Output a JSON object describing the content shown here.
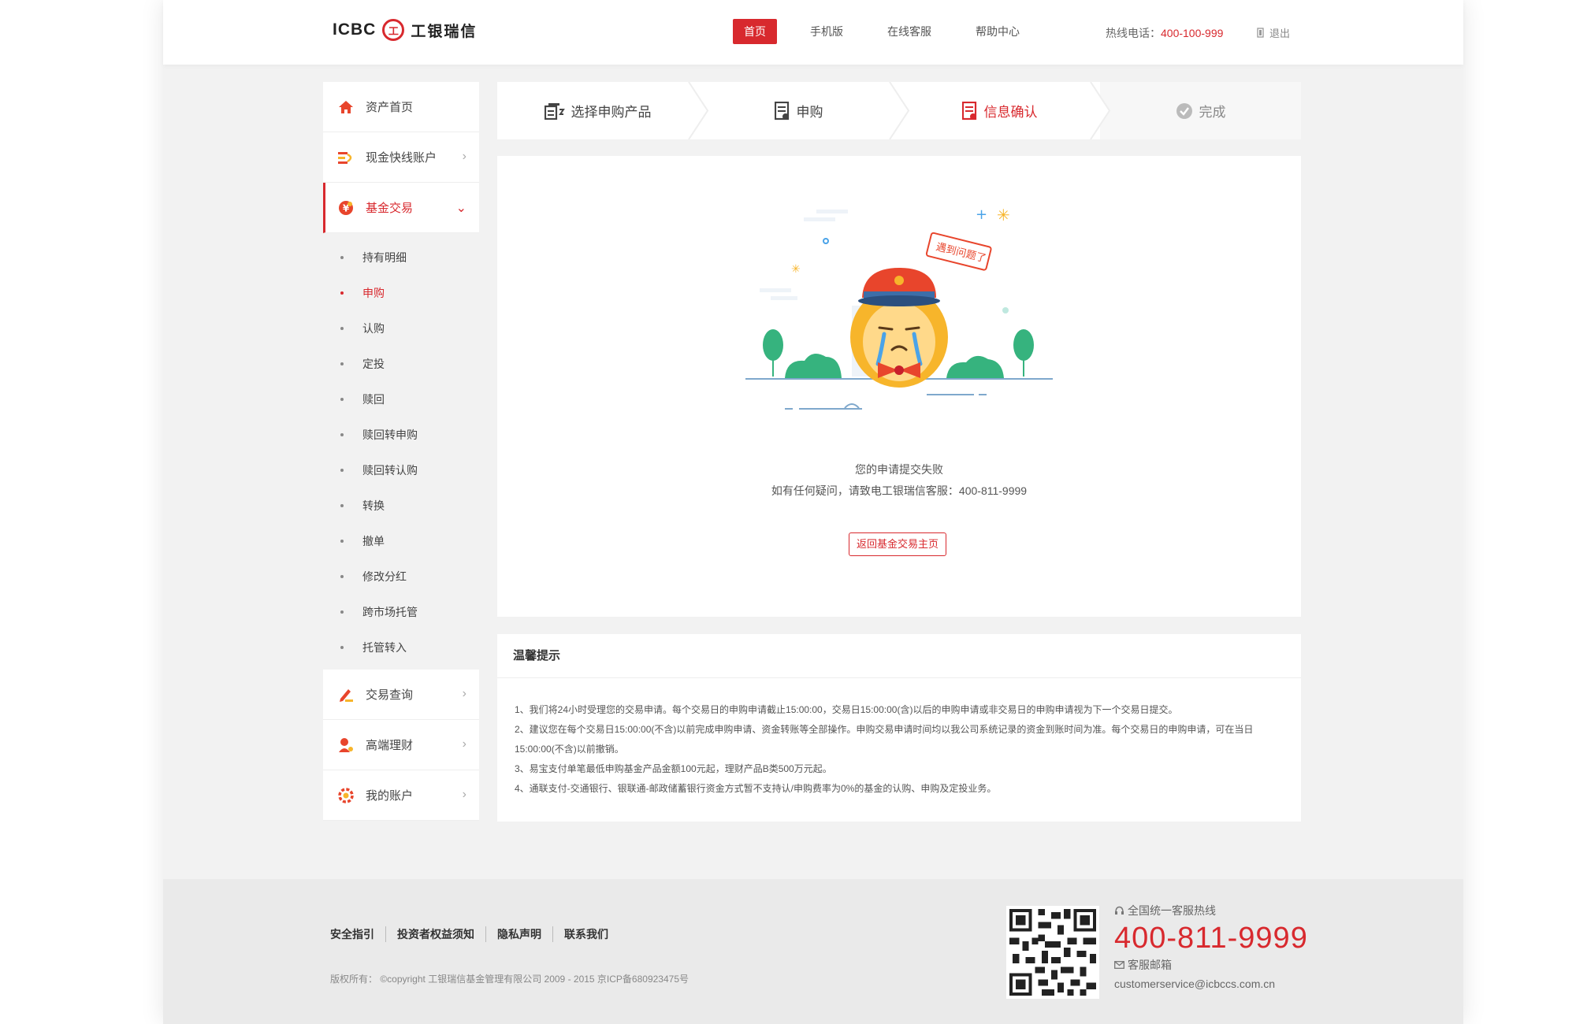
{
  "header": {
    "brand": "ICBC",
    "brand_mark": "工",
    "brand_cn": "工银瑞信",
    "nav": [
      "首页",
      "手机版",
      "在线客服",
      "帮助中心"
    ],
    "hotline_label": "热线电话：",
    "hotline_number": "400-100-999",
    "logout": "退出"
  },
  "sidebar": {
    "items": [
      {
        "label": "资产首页",
        "icon": "home-icon"
      },
      {
        "label": "现金快线账户",
        "icon": "cash-icon"
      },
      {
        "label": "基金交易",
        "icon": "fund-icon"
      },
      {
        "label": "交易查询",
        "icon": "query-icon"
      },
      {
        "label": "高端理财",
        "icon": "wealth-icon"
      },
      {
        "label": "我的账户",
        "icon": "account-icon"
      }
    ],
    "sub_items": [
      "持有明细",
      "申购",
      "认购",
      "定投",
      "赎回",
      "赎回转申购",
      "赎回转认购",
      "转换",
      "撤单",
      "修改分红",
      "跨市场托管",
      "托管转入"
    ]
  },
  "steps": [
    "选择申购产品",
    "申购",
    "信息确认",
    "完成"
  ],
  "result": {
    "badge": "遇到问题了",
    "line1": "您的申请提交失败",
    "line2": "如有任何疑问，请致电工银瑞信客服：400-811-9999",
    "button": "返回基金交易主页"
  },
  "tips": {
    "title": "温馨提示",
    "lines": [
      "1、我们将24小时受理您的交易申请。每个交易日的申购申请截止15:00:00，交易日15:00:00(含)以后的申购申请或非交易日的申购申请视为下一个交易日提交。",
      "2、建议您在每个交易日15:00:00(不含)以前完成申购申请、资金转账等全部操作。申购交易申请时间均以我公司系统记录的资金到账时间为准。每个交易日的申购申请，可在当日",
      "15:00:00(不含)以前撤销。",
      "3、易宝支付单笔最低申购基金产品金额100元起，理财产品B类500万元起。",
      "4、通联支付-交通银行、银联通-邮政储蓄银行资金方式暂不支持认/申购费率为0%的基金的认购、申购及定投业务。"
    ]
  },
  "footer": {
    "links": [
      "安全指引",
      "投资者权益须知",
      "隐私声明",
      "联系我们"
    ],
    "copyright": "版权所有：  ©copyright 工银瑞信基金管理有限公司 2009 - 2015 京ICP备680923475号",
    "hotline_label": "全国统一客服热线",
    "phone": "400-811-9999",
    "mail_label": "客服邮箱",
    "mail": "customerservice@icbccs.com.cn"
  },
  "colors": {
    "accent": "#d8292e",
    "green": "#36b37e",
    "yellow": "#f7b52b"
  }
}
